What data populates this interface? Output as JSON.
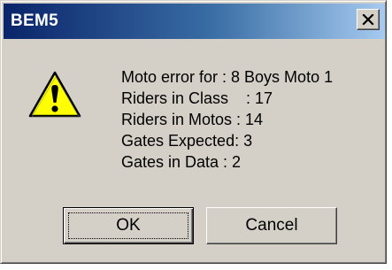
{
  "window": {
    "title": "BEM5",
    "close_icon": "close-x-icon"
  },
  "icon": {
    "name": "warning-icon",
    "color": "#ffff00"
  },
  "message": {
    "lines": [
      "Moto error for : 8 Boys Moto 1",
      "Riders in Class    : 17",
      "Riders in Motos : 14",
      "Gates Expected: 3",
      "Gates in Data : 2"
    ]
  },
  "buttons": {
    "ok_label": "OK",
    "cancel_label": "Cancel"
  },
  "colors": {
    "titlebar_start": "#0a246a",
    "titlebar_end": "#a6caf0",
    "dialog_bg": "#d4d0c8"
  }
}
